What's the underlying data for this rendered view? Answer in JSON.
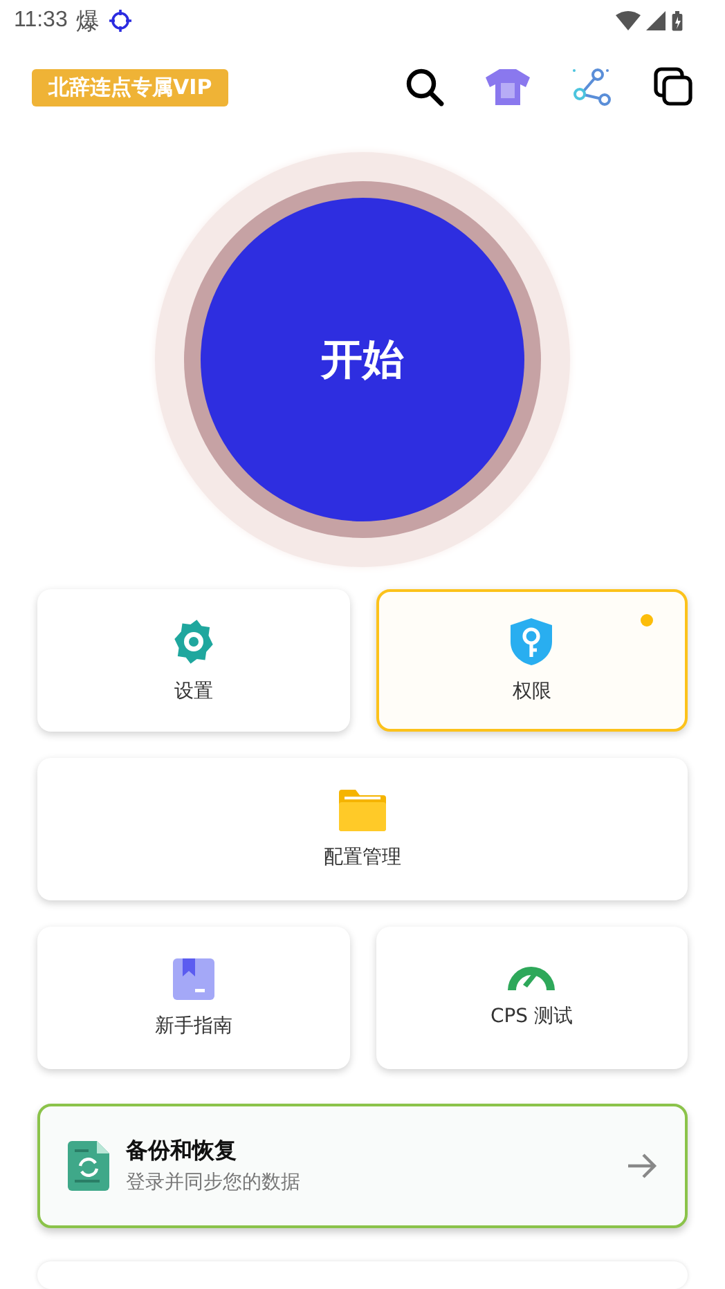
{
  "status_bar": {
    "time": "11:33",
    "badge": "爆"
  },
  "header": {
    "vip_label": "北辞连点专属VIP"
  },
  "start_button": {
    "label": "开始"
  },
  "tiles": [
    {
      "kind": "gear",
      "label": "设置",
      "wide": false,
      "highlighted": false,
      "alert": false
    },
    {
      "kind": "shield",
      "label": "权限",
      "wide": false,
      "highlighted": true,
      "alert": true
    },
    {
      "kind": "folder",
      "label": "配置管理",
      "wide": true,
      "highlighted": false,
      "alert": false
    },
    {
      "kind": "book",
      "label": "新手指南",
      "wide": false,
      "highlighted": false,
      "alert": false
    },
    {
      "kind": "gauge",
      "label": "CPS 测试",
      "wide": false,
      "highlighted": false,
      "alert": false
    }
  ],
  "backup_card": {
    "title": "备份和恢复",
    "subtitle": "登录并同步您的数据"
  }
}
